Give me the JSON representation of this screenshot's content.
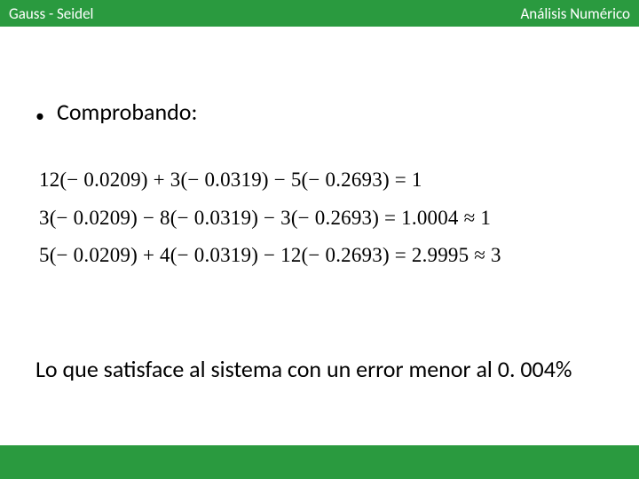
{
  "header": {
    "left": "Gauss - Seidel",
    "right": "Análisis Numérico"
  },
  "bullet": {
    "label": "Comprobando:"
  },
  "equations": {
    "line1": "12(− 0.0209) + 3(− 0.0319) − 5(− 0.2693) = 1",
    "line2": "3(− 0.0209) − 8(− 0.0319) − 3(− 0.2693) = 1.0004 ≈ 1",
    "line3": "5(− 0.0209) + 4(− 0.0319) − 12(− 0.2693) = 2.9995 ≈ 3"
  },
  "conclusion": {
    "text": "Lo que satisface al sistema con un error menor al 0. 004%"
  }
}
